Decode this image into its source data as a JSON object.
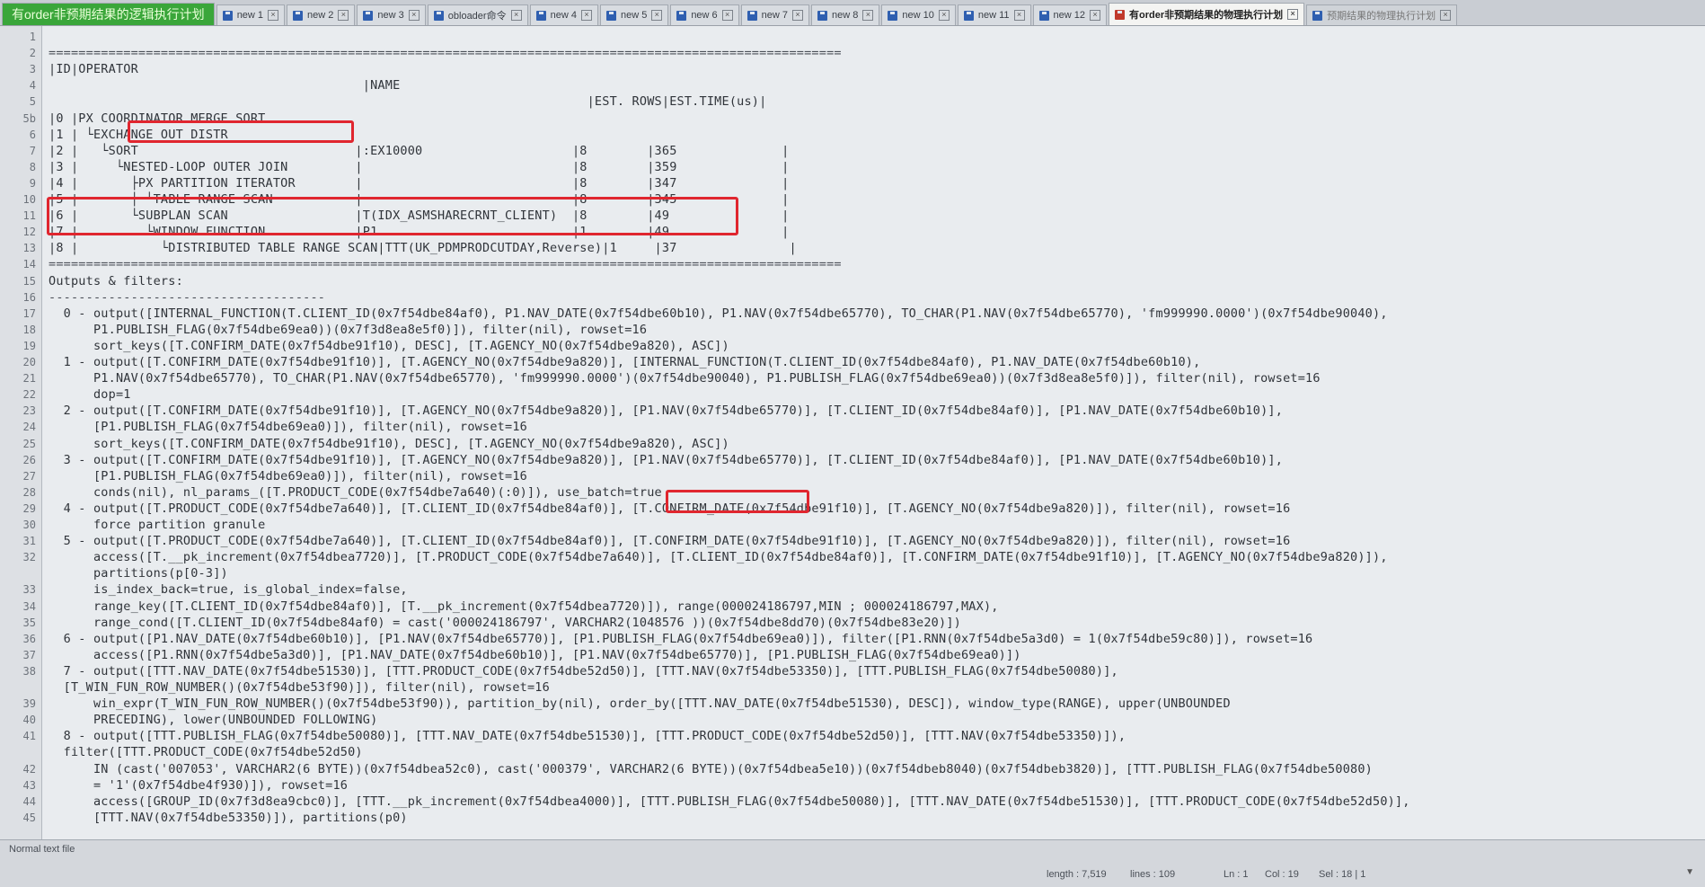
{
  "tabs": [
    {
      "label": "有order非预期结果的逻辑执行计划",
      "kind": "first",
      "icon": "floppy-icon"
    },
    {
      "label": "new 1",
      "kind": "normal",
      "icon": "floppy-icon"
    },
    {
      "label": "new 2",
      "kind": "normal",
      "icon": "floppy-icon"
    },
    {
      "label": "new 3",
      "kind": "normal",
      "icon": "floppy-icon"
    },
    {
      "label": "obloader命令",
      "kind": "normal",
      "icon": "floppy-icon"
    },
    {
      "label": "new 4",
      "kind": "normal",
      "icon": "floppy-icon"
    },
    {
      "label": "new 5",
      "kind": "normal",
      "icon": "floppy-icon"
    },
    {
      "label": "new 6",
      "kind": "normal",
      "icon": "floppy-icon"
    },
    {
      "label": "new 7",
      "kind": "normal",
      "icon": "floppy-icon"
    },
    {
      "label": "new 8",
      "kind": "normal",
      "icon": "floppy-icon"
    },
    {
      "label": "new 10",
      "kind": "normal",
      "icon": "floppy-icon"
    },
    {
      "label": "new 11",
      "kind": "normal",
      "icon": "floppy-icon"
    },
    {
      "label": "new 12",
      "kind": "normal",
      "icon": "floppy-icon"
    },
    {
      "label": "有order非预期结果的物理执行计划",
      "kind": "active",
      "icon": "floppy-red-icon"
    },
    {
      "label": "预期结果的物理执行计划",
      "kind": "last",
      "icon": "floppy-icon"
    }
  ],
  "lines": [
    {
      "n": "1",
      "text": ""
    },
    {
      "n": "2",
      "text": "=========================================================================================================="
    },
    {
      "n": "3",
      "text": "|ID|OPERATOR"
    },
    {
      "n": "4",
      "text": "                                          |NAME"
    },
    {
      "n": "5",
      "text": "                                                                        |EST. ROWS|EST.TIME(us)|"
    },
    {
      "n": "5b",
      "text": "|0 |PX COORDINATOR MERGE SORT"
    },
    {
      "n": "6",
      "text": "|1 | └EXCHANGE OUT DISTR"
    },
    {
      "n": "7",
      "text": "|2 |   └SORT                             |:EX10000                    |8        |365              |"
    },
    {
      "n": "8",
      "text": "|3 |     └NESTED-LOOP OUTER JOIN         |                            |8        |359              |"
    },
    {
      "n": "9",
      "text": "|4 |       ├PX PARTITION ITERATOR        |                            |8        |347              |"
    },
    {
      "n": "10",
      "text": "|5 |       │ └TABLE RANGE SCAN           |                            |8        |345              |"
    },
    {
      "n": "11",
      "text": "|6 |       └SUBPLAN SCAN                 |T(IDX_ASMSHARECRNT_CLIENT)  |8        |49               |"
    },
    {
      "n": "12",
      "text": "|7 |         └WINDOW FUNCTION            |P1                          |1        |49               |"
    },
    {
      "n": "13",
      "text": "|8 |           └DISTRIBUTED TABLE RANGE SCAN|TTT(UK_PDMPRODCUTDAY,Reverse)|1     |37               |"
    },
    {
      "n": "14",
      "text": "=========================================================================================================="
    },
    {
      "n": "15",
      "text": "Outputs & filters:"
    },
    {
      "n": "16",
      "text": "-------------------------------------"
    },
    {
      "n": "17",
      "text": "  0 - output([INTERNAL_FUNCTION(T.CLIENT_ID(0x7f54dbe84af0), P1.NAV_DATE(0x7f54dbe60b10), P1.NAV(0x7f54dbe65770), TO_CHAR(P1.NAV(0x7f54dbe65770), 'fm999990.0000')(0x7f54dbe90040),"
    },
    {
      "n": "18",
      "text": "      P1.PUBLISH_FLAG(0x7f54dbe69ea0))(0x7f3d8ea8e5f0)]), filter(nil), rowset=16"
    },
    {
      "n": "19",
      "text": "      sort_keys([T.CONFIRM_DATE(0x7f54dbe91f10), DESC], [T.AGENCY_NO(0x7f54dbe9a820), ASC])"
    },
    {
      "n": "20",
      "text": "  1 - output([T.CONFIRM_DATE(0x7f54dbe91f10)], [T.AGENCY_NO(0x7f54dbe9a820)], [INTERNAL_FUNCTION(T.CLIENT_ID(0x7f54dbe84af0), P1.NAV_DATE(0x7f54dbe60b10),"
    },
    {
      "n": "21",
      "text": "      P1.NAV(0x7f54dbe65770), TO_CHAR(P1.NAV(0x7f54dbe65770), 'fm999990.0000')(0x7f54dbe90040), P1.PUBLISH_FLAG(0x7f54dbe69ea0))(0x7f3d8ea8e5f0)]), filter(nil), rowset=16"
    },
    {
      "n": "22",
      "text": "      dop=1"
    },
    {
      "n": "23",
      "text": "  2 - output([T.CONFIRM_DATE(0x7f54dbe91f10)], [T.AGENCY_NO(0x7f54dbe9a820)], [P1.NAV(0x7f54dbe65770)], [T.CLIENT_ID(0x7f54dbe84af0)], [P1.NAV_DATE(0x7f54dbe60b10)],"
    },
    {
      "n": "24",
      "text": "      [P1.PUBLISH_FLAG(0x7f54dbe69ea0)]), filter(nil), rowset=16"
    },
    {
      "n": "25",
      "text": "      sort_keys([T.CONFIRM_DATE(0x7f54dbe91f10), DESC], [T.AGENCY_NO(0x7f54dbe9a820), ASC])"
    },
    {
      "n": "26",
      "text": "  3 - output([T.CONFIRM_DATE(0x7f54dbe91f10)], [T.AGENCY_NO(0x7f54dbe9a820)], [P1.NAV(0x7f54dbe65770)], [T.CLIENT_ID(0x7f54dbe84af0)], [P1.NAV_DATE(0x7f54dbe60b10)],"
    },
    {
      "n": "27",
      "text": "      [P1.PUBLISH_FLAG(0x7f54dbe69ea0)]), filter(nil), rowset=16"
    },
    {
      "n": "28",
      "text": "      conds(nil), nl_params_([T.PRODUCT_CODE(0x7f54dbe7a640)(:0)]), use_batch=true"
    },
    {
      "n": "29",
      "text": "  4 - output([T.PRODUCT_CODE(0x7f54dbe7a640)], [T.CLIENT_ID(0x7f54dbe84af0)], [T.CONFIRM_DATE(0x7f54dbe91f10)], [T.AGENCY_NO(0x7f54dbe9a820)]), filter(nil), rowset=16"
    },
    {
      "n": "30",
      "text": "      force partition granule"
    },
    {
      "n": "31",
      "text": "  5 - output([T.PRODUCT_CODE(0x7f54dbe7a640)], [T.CLIENT_ID(0x7f54dbe84af0)], [T.CONFIRM_DATE(0x7f54dbe91f10)], [T.AGENCY_NO(0x7f54dbe9a820)]), filter(nil), rowset=16"
    },
    {
      "n": "32",
      "text": "      access([T.__pk_increment(0x7f54dbea7720)], [T.PRODUCT_CODE(0x7f54dbe7a640)], [T.CLIENT_ID(0x7f54dbe84af0)], [T.CONFIRM_DATE(0x7f54dbe91f10)], [T.AGENCY_NO(0x7f54dbe9a820)]),"
    },
    {
      "n": "",
      "text": "      partitions(p[0-3])"
    },
    {
      "n": "33",
      "text": "      is_index_back=true, is_global_index=false,"
    },
    {
      "n": "34",
      "text": "      range_key([T.CLIENT_ID(0x7f54dbe84af0)], [T.__pk_increment(0x7f54dbea7720)]), range(000024186797,MIN ; 000024186797,MAX),"
    },
    {
      "n": "35",
      "text": "      range_cond([T.CLIENT_ID(0x7f54dbe84af0) = cast('000024186797', VARCHAR2(1048576 ))(0x7f54dbe8dd70)(0x7f54dbe83e20)])"
    },
    {
      "n": "36",
      "text": "  6 - output([P1.NAV_DATE(0x7f54dbe60b10)], [P1.NAV(0x7f54dbe65770)], [P1.PUBLISH_FLAG(0x7f54dbe69ea0)]), filter([P1.RNN(0x7f54dbe5a3d0) = 1(0x7f54dbe59c80)]), rowset=16"
    },
    {
      "n": "37",
      "text": "      access([P1.RNN(0x7f54dbe5a3d0)], [P1.NAV_DATE(0x7f54dbe60b10)], [P1.NAV(0x7f54dbe65770)], [P1.PUBLISH_FLAG(0x7f54dbe69ea0)])"
    },
    {
      "n": "38",
      "text": "  7 - output([TTT.NAV_DATE(0x7f54dbe51530)], [TTT.PRODUCT_CODE(0x7f54dbe52d50)], [TTT.NAV(0x7f54dbe53350)], [TTT.PUBLISH_FLAG(0x7f54dbe50080)],"
    },
    {
      "n": "",
      "text": "  [T_WIN_FUN_ROW_NUMBER()(0x7f54dbe53f90)]), filter(nil), rowset=16"
    },
    {
      "n": "39",
      "text": "      win_expr(T_WIN_FUN_ROW_NUMBER()(0x7f54dbe53f90)), partition_by(nil), order_by([TTT.NAV_DATE(0x7f54dbe51530), DESC]), window_type(RANGE), upper(UNBOUNDED"
    },
    {
      "n": "40",
      "text": "      PRECEDING), lower(UNBOUNDED FOLLOWING)"
    },
    {
      "n": "41",
      "text": "  8 - output([TTT.PUBLISH_FLAG(0x7f54dbe50080)], [TTT.NAV_DATE(0x7f54dbe51530)], [TTT.PRODUCT_CODE(0x7f54dbe52d50)], [TTT.NAV(0x7f54dbe53350)]),"
    },
    {
      "n": "",
      "text": "  filter([TTT.PRODUCT_CODE(0x7f54dbe52d50)"
    },
    {
      "n": "42",
      "text": "      IN (cast('007053', VARCHAR2(6 BYTE))(0x7f54dbea52c0), cast('000379', VARCHAR2(6 BYTE))(0x7f54dbea5e10))(0x7f54dbeb8040)(0x7f54dbeb3820)], [TTT.PUBLISH_FLAG(0x7f54dbe50080)"
    },
    {
      "n": "43",
      "text": "      = '1'(0x7f54dbe4f930)]), rowset=16"
    },
    {
      "n": "44",
      "text": "      access([GROUP_ID(0x7f3d8ea9cbc0)], [TTT.__pk_increment(0x7f54dbea4000)], [TTT.PUBLISH_FLAG(0x7f54dbe50080)], [TTT.NAV_DATE(0x7f54dbe51530)], [TTT.PRODUCT_CODE(0x7f54dbe52d50)],"
    },
    {
      "n": "45",
      "text": "      [TTT.NAV(0x7f54dbe53350)]), partitions(p0)"
    }
  ],
  "status": {
    "file_type": "Normal text file",
    "length": "length : 7,519",
    "lines": "lines : 109",
    "ln": "Ln : 1",
    "col": "Col : 19",
    "sel": "Sel : 18 | 1",
    "scroll_arrow": "▼"
  }
}
